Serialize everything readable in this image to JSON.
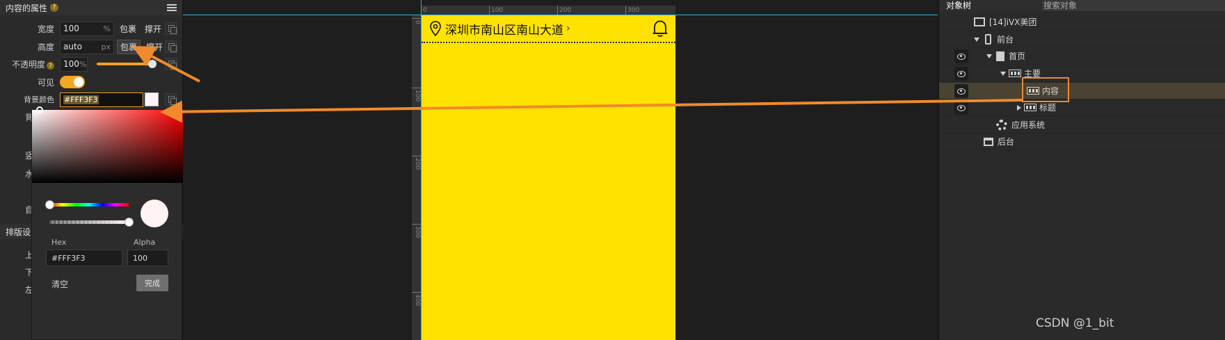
{
  "left_panel": {
    "title": "内容的属性",
    "help_mark": "?",
    "rows": {
      "width": {
        "label": "宽度",
        "value": "100",
        "unit": "%",
        "wrap": "包裹",
        "stretch": "撑开"
      },
      "height": {
        "label": "高度",
        "value": "auto",
        "unit": "px",
        "wrap": "包裹",
        "stretch": "撑开"
      },
      "opacity": {
        "label": "不透明度",
        "value": "100",
        "unit": "%",
        "slider_value": 100
      },
      "visible": {
        "label": "可见",
        "state": true
      },
      "bg_color": {
        "label": "背景颜色",
        "value": "#FFF3F3"
      }
    },
    "side_labels": [
      "背",
      "竖",
      "水",
      "自"
    ],
    "section2_title": "排版设",
    "section2_labels": [
      "上",
      "下",
      "左"
    ]
  },
  "color_picker": {
    "hex_label": "Hex",
    "alpha_label": "Alpha",
    "hex_value": "#FFF3F3",
    "alpha_value": "100",
    "clear_label": "清空",
    "done_label": "完成",
    "color": "#FFF3F3"
  },
  "canvas": {
    "ruler_top_ticks": [
      "0",
      "100",
      "200",
      "300"
    ],
    "ruler_left_ticks": [
      "0",
      "100",
      "200",
      "300",
      "400"
    ],
    "phone_bg": "#FFE200",
    "address": "深圳市南山区南山大道",
    "chevron": "›",
    "icons": [
      "location-pin-icon",
      "bell-icon"
    ]
  },
  "tree": {
    "tab_active": "对象树",
    "tab_search": "搜索对象",
    "nodes": [
      {
        "label": "[14]iVX美团",
        "icon": "app-icon"
      },
      {
        "label": "前台",
        "icon": "phone-icon"
      },
      {
        "label": "首页",
        "icon": "page-icon"
      },
      {
        "label": "主要",
        "icon": "row-icon"
      },
      {
        "label": "内容",
        "icon": "row-icon",
        "selected": true
      },
      {
        "label": "标题",
        "icon": "row-icon"
      },
      {
        "label": "应用系统",
        "icon": "gear-icon"
      },
      {
        "label": "后台",
        "icon": "backend-icon"
      }
    ]
  },
  "accent_colors": {
    "orange": "#F5A623",
    "arrow": "#F08A2C",
    "guide": "#31B2C7"
  },
  "watermark": "CSDN @1_bit"
}
